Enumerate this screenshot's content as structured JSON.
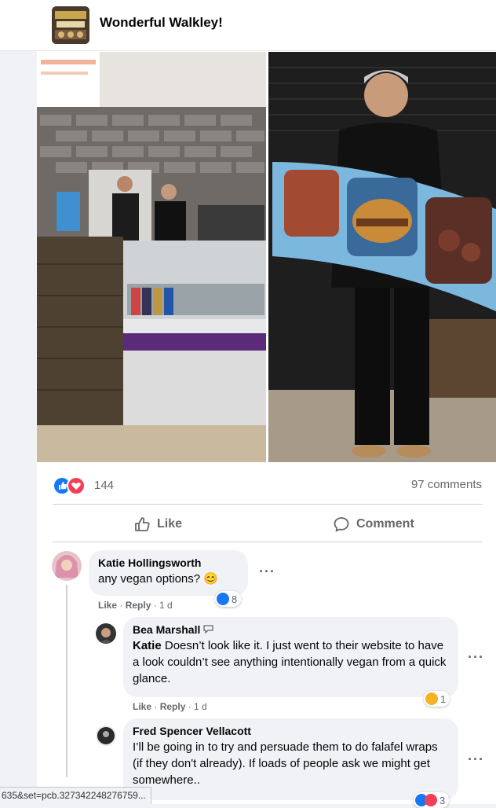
{
  "group": {
    "title": "Wonderful Walkley!"
  },
  "post": {
    "reactions_count": "144",
    "comments_count": "97 comments",
    "actions": {
      "like": "Like",
      "comment": "Comment"
    }
  },
  "comments": [
    {
      "author": "Katie Hollingsworth",
      "text": "any vegan options? 😊",
      "like": "Like",
      "reply": "Reply",
      "time": "1 d",
      "reactions": "8"
    },
    {
      "author": "Bea Marshall",
      "mention": "Katie",
      "text": "Doesn’t look like it. I just went to their website to have a look couldn’t see anything intentionally vegan from a quick glance.",
      "like": "Like",
      "reply": "Reply",
      "time": "1 d",
      "reactions": "1"
    },
    {
      "author": "Fred Spencer Vellacott",
      "text": "I’ll be going in to try and persuade them to do falafel wraps (if they don't already). If loads of people ask we might get somewhere..",
      "reactions": "3"
    }
  ],
  "status_url": "635&set=pcb.327342248276759...",
  "colors": {
    "like_blue": "#1877f2",
    "love_red": "#f33e58",
    "secondary_text": "#65676b"
  }
}
